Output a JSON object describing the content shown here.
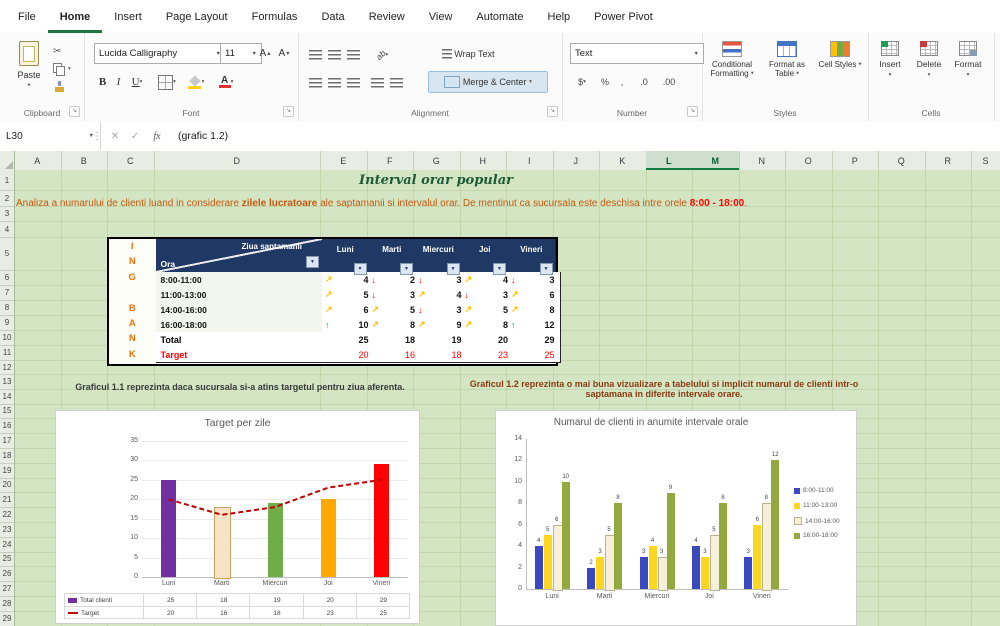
{
  "menu": {
    "tabs": [
      "File",
      "Home",
      "Insert",
      "Page Layout",
      "Formulas",
      "Data",
      "Review",
      "View",
      "Automate",
      "Help",
      "Power Pivot"
    ],
    "active": "Home"
  },
  "ribbon": {
    "clipboard": {
      "label": "Clipboard",
      "paste_label": "Paste"
    },
    "font": {
      "label": "Font",
      "font_name": "Lucida Calligraphy",
      "font_size": "11",
      "bold": "B",
      "italic": "I",
      "underline": "U",
      "grow": "A",
      "shrink": "A"
    },
    "alignment": {
      "label": "Alignment",
      "wrap_text": "Wrap Text",
      "merge_center": "Merge & Center",
      "orientation": "ab"
    },
    "number": {
      "label": "Number",
      "format": "Text",
      "currency": "$",
      "percent": "%",
      "comma": ",",
      "dec_inc": ".0",
      "dec_dec": ".00"
    },
    "styles": {
      "label": "Styles",
      "conditional": "Conditional Formatting",
      "format_table": "Format as Table",
      "cell_styles": "Cell Styles"
    },
    "cells": {
      "label": "Cells",
      "insert": "Insert",
      "delete": "Delete",
      "format": "Format"
    }
  },
  "formula_bar": {
    "name_box": "L30",
    "cancel": "✕",
    "enter": "✓",
    "fx": "fx",
    "formula": "(grafic 1.2)"
  },
  "grid": {
    "columns": [
      "A",
      "B",
      "C",
      "D",
      "E",
      "F",
      "G",
      "H",
      "I",
      "J",
      "K",
      "L",
      "M",
      "N",
      "O",
      "P",
      "Q",
      "R",
      "S"
    ],
    "selected_columns": [
      "L",
      "M"
    ],
    "row_count": 29
  },
  "sheet": {
    "title": "Interval orar popular",
    "description": {
      "part1": "Analiza a numarului de clienti luand in considerare ",
      "bold1": "zilele lucratoare",
      "part2": " ale saptamanii si intervalul orar. De mentinut ca sucursala este deschisa intre orele ",
      "bold2": "8:00 - 18:00",
      "part3": "."
    },
    "bank_letters": [
      "I",
      "N",
      "G",
      "",
      "B",
      "A",
      "N",
      "K"
    ],
    "table": {
      "corner_top": "Ziua saptamanii",
      "corner_bottom": "Ora",
      "days": [
        "Luni",
        "Marti",
        "Miercuri",
        "Joi",
        "Vineri"
      ],
      "rows": [
        {
          "ora": "8:00-11:00",
          "cells": [
            {
              "v": 4,
              "icon": "diag"
            },
            {
              "v": 2,
              "icon": "down"
            },
            {
              "v": 3,
              "icon": "down"
            },
            {
              "v": 4,
              "icon": "diag"
            },
            {
              "v": 3,
              "icon": "down"
            }
          ]
        },
        {
          "ora": "11:00-13:00",
          "cells": [
            {
              "v": 5,
              "icon": "diag"
            },
            {
              "v": 3,
              "icon": "down"
            },
            {
              "v": 4,
              "icon": "diag"
            },
            {
              "v": 3,
              "icon": "down"
            },
            {
              "v": 6,
              "icon": "diag"
            }
          ]
        },
        {
          "ora": "14:00-16:00",
          "cells": [
            {
              "v": 6,
              "icon": "diag"
            },
            {
              "v": 5,
              "icon": "diag"
            },
            {
              "v": 3,
              "icon": "down"
            },
            {
              "v": 5,
              "icon": "diag"
            },
            {
              "v": 8,
              "icon": "diag"
            }
          ]
        },
        {
          "ora": "16:00-18:00",
          "cells": [
            {
              "v": 10,
              "icon": "up"
            },
            {
              "v": 8,
              "icon": "diag"
            },
            {
              "v": 9,
              "icon": "diag"
            },
            {
              "v": 8,
              "icon": "diag"
            },
            {
              "v": 12,
              "icon": "up"
            }
          ]
        }
      ],
      "total": {
        "label": "Total",
        "values": [
          25,
          18,
          19,
          20,
          29
        ]
      },
      "target": {
        "label": "Target",
        "values": [
          20,
          16,
          18,
          23,
          25
        ]
      }
    },
    "caption_left": "Graficul 1.1 reprezinta daca sucursala si-a atins targetul pentru ziua aferenta.",
    "caption_right": "Graficul 1.2 reprezinta o mai buna vizualizare a tabelului si implicit numarul de clienti intr-o saptamana in diferite intervale orare."
  },
  "icon_colors": {
    "up": "#00B050",
    "diag": "#FFC000",
    "down": "#FF0000"
  },
  "chart_data": [
    {
      "type": "bar",
      "title": "Target per zile",
      "categories": [
        "Luni",
        "Marti",
        "Miercuri",
        "Joi",
        "Vineri"
      ],
      "series": [
        {
          "name": "Total clienti",
          "type": "column",
          "values": [
            25,
            18,
            19,
            20,
            29
          ],
          "bar_colors": [
            "#7030A0",
            "#F7E4C6",
            "#70AD47",
            "#FFA800",
            "#FF0000"
          ]
        },
        {
          "name": "Target",
          "type": "line",
          "line_style": "dashed",
          "color": "#C00000",
          "values": [
            20,
            16,
            18,
            23,
            25
          ]
        }
      ],
      "ylim": [
        0,
        35
      ],
      "yticks": [
        0,
        5,
        10,
        15,
        20,
        25,
        30,
        35
      ],
      "grid": true,
      "data_table": true,
      "legend_position": "data-table"
    },
    {
      "type": "bar",
      "title": "Numarul de clienti in anumite intervale orale",
      "categories": [
        "Luni",
        "Marti",
        "Miercuri",
        "Joi",
        "Vineri"
      ],
      "series": [
        {
          "name": "8:00-11:00",
          "color": "#3B49C1",
          "values": [
            4,
            2,
            3,
            4,
            3
          ]
        },
        {
          "name": "11:00-13:00",
          "color": "#FFD61F",
          "values": [
            5,
            3,
            4,
            3,
            6
          ]
        },
        {
          "name": "14:00-16:00",
          "color": "#F6F0DB",
          "values": [
            6,
            5,
            3,
            5,
            8
          ]
        },
        {
          "name": "16:00-18:00",
          "color": "#93A83D",
          "values": [
            10,
            8,
            9,
            8,
            12
          ]
        }
      ],
      "ylim": [
        0,
        14
      ],
      "yticks": [
        0,
        2,
        4,
        6,
        8,
        10,
        12,
        14
      ],
      "grid": false,
      "data_labels": true,
      "legend_position": "right"
    }
  ]
}
